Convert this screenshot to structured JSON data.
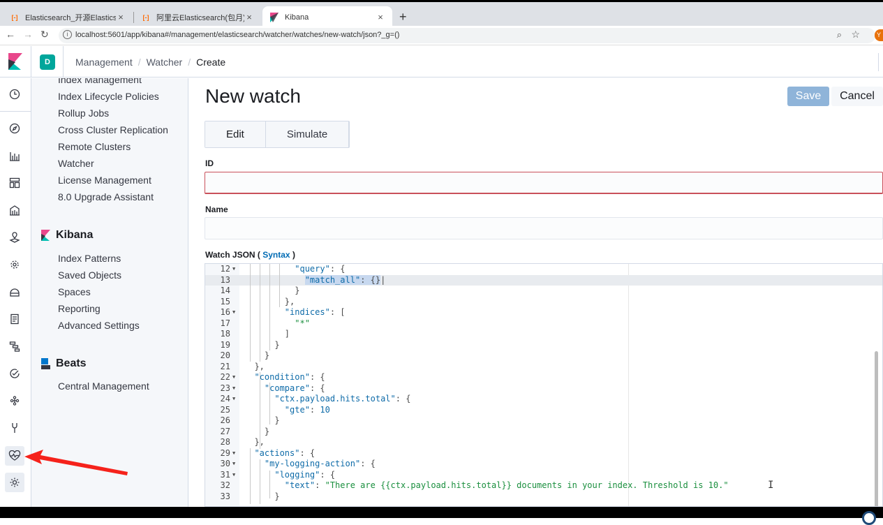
{
  "browser": {
    "tabs": [
      {
        "title": "Elasticsearch_开源Elasticsearch",
        "icon": "aliyun-icon"
      },
      {
        "title": "阿里云Elasticsearch(包月)-购买",
        "icon": "aliyun-icon"
      },
      {
        "title": "Kibana",
        "icon": "kibana-icon"
      }
    ],
    "url": "localhost:5601/app/kibana#/management/elasticsearch/watcher/watches/new-watch/json?_g=()",
    "profile_initial": "Y"
  },
  "header": {
    "space_initial": "D",
    "breadcrumbs": [
      "Management",
      "Watcher",
      "Create"
    ]
  },
  "sidebar": {
    "es_items": [
      "Index Management",
      "Index Lifecycle Policies",
      "Rollup Jobs",
      "Cross Cluster Replication",
      "Remote Clusters",
      "Watcher",
      "License Management",
      "8.0 Upgrade Assistant"
    ],
    "kibana_title": "Kibana",
    "kibana_items": [
      "Index Patterns",
      "Saved Objects",
      "Spaces",
      "Reporting",
      "Advanced Settings"
    ],
    "beats_title": "Beats",
    "beats_items": [
      "Central Management"
    ]
  },
  "main": {
    "title": "New watch",
    "save_label": "Save",
    "cancel_label": "Cancel",
    "tabs": [
      "Edit",
      "Simulate"
    ],
    "id_label": "ID",
    "name_label": "Name",
    "json_label": "Watch JSON",
    "syntax_link": "Syntax"
  },
  "code": {
    "lines": [
      {
        "n": "12",
        "fold": true
      },
      {
        "n": "13",
        "fold": false
      },
      {
        "n": "14",
        "fold": false
      },
      {
        "n": "15",
        "fold": false
      },
      {
        "n": "16",
        "fold": true
      },
      {
        "n": "17",
        "fold": false
      },
      {
        "n": "18",
        "fold": false
      },
      {
        "n": "19",
        "fold": false
      },
      {
        "n": "20",
        "fold": false
      },
      {
        "n": "21",
        "fold": false
      },
      {
        "n": "22",
        "fold": true
      },
      {
        "n": "23",
        "fold": true
      },
      {
        "n": "24",
        "fold": true
      },
      {
        "n": "25",
        "fold": false
      },
      {
        "n": "26",
        "fold": false
      },
      {
        "n": "27",
        "fold": false
      },
      {
        "n": "28",
        "fold": false
      },
      {
        "n": "29",
        "fold": true
      },
      {
        "n": "30",
        "fold": true
      },
      {
        "n": "31",
        "fold": true
      },
      {
        "n": "32",
        "fold": false
      },
      {
        "n": "33",
        "fold": false
      }
    ],
    "keys": {
      "query": "\"query\"",
      "match_all": "\"match_all\"",
      "indices": "\"indices\"",
      "star": "\"*\"",
      "condition": "\"condition\"",
      "compare": "\"compare\"",
      "hits_total": "\"ctx.payload.hits.total\"",
      "gte": "\"gte\"",
      "gte_value": "10",
      "actions": "\"actions\"",
      "logging_action": "\"my-logging-action\"",
      "logging": "\"logging\"",
      "text": "\"text\"",
      "text_value": "\"There are {{ctx.payload.hits.total}} documents in your index. Threshold is 10.\""
    }
  },
  "nav_icons": [
    "clock-icon",
    "compass-icon",
    "visualize-icon",
    "dashboard-icon",
    "canvas-icon",
    "maps-icon",
    "ml-icon",
    "infrastructure-icon",
    "logs-icon",
    "apm-icon",
    "uptime-icon",
    "graph-icon",
    "devtools-icon",
    "monitoring-icon",
    "management-icon"
  ]
}
